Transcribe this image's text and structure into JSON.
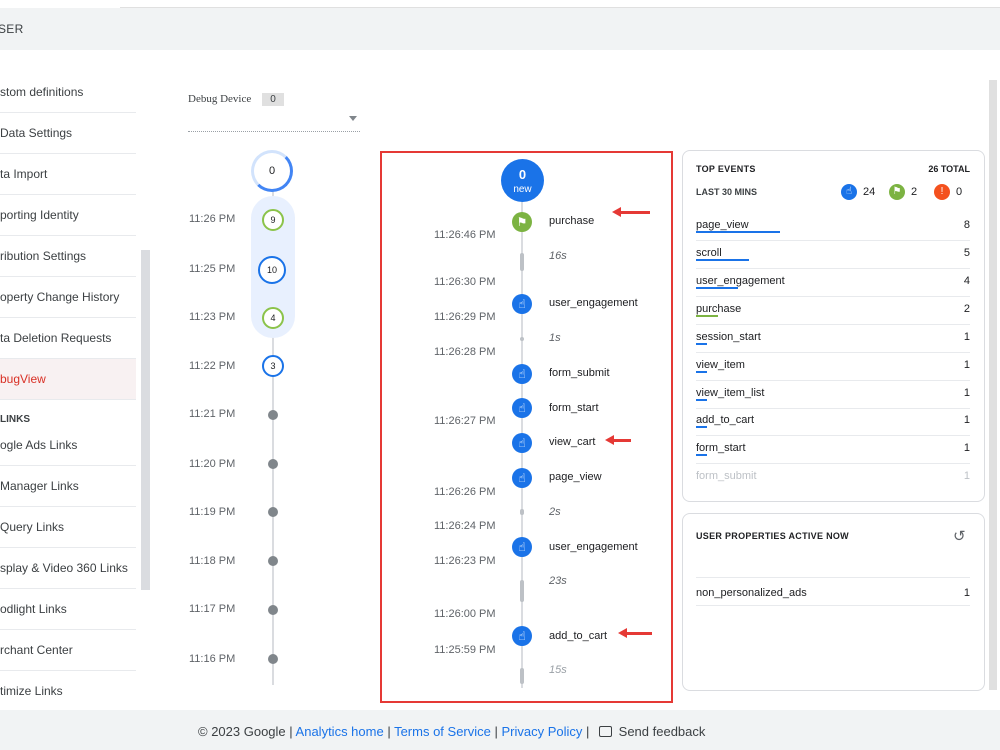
{
  "header": {
    "title": "SER"
  },
  "sidebar": {
    "items": [
      {
        "label": "stom definitions"
      },
      {
        "label": "Data Settings"
      },
      {
        "label": "ta Import"
      },
      {
        "label": "porting Identity"
      },
      {
        "label": "ribution Settings"
      },
      {
        "label": "operty Change History"
      },
      {
        "label": "ta Deletion Requests"
      },
      {
        "label": "bugView"
      }
    ],
    "links_heading": "LINKS",
    "link_items": [
      {
        "label": "ogle Ads Links"
      },
      {
        "label": "Manager Links"
      },
      {
        "label": "Query Links"
      },
      {
        "label": "splay & Video 360 Links"
      },
      {
        "label": "odlight Links"
      },
      {
        "label": "rchant Center"
      },
      {
        "label": "timize Links"
      }
    ]
  },
  "debug_device": {
    "label": "Debug Device",
    "count": "0"
  },
  "minutes_timeline": {
    "top_count": "0",
    "nodes": [
      {
        "time": "11:26 PM",
        "count": "9"
      },
      {
        "time": "11:25 PM",
        "count": "10"
      },
      {
        "time": "11:23 PM",
        "count": "4"
      },
      {
        "time": "11:22 PM",
        "count": "3"
      }
    ],
    "dots": [
      {
        "time": "11:21 PM"
      },
      {
        "time": "11:20 PM"
      },
      {
        "time": "11:19 PM"
      },
      {
        "time": "11:18 PM"
      },
      {
        "time": "11:17 PM"
      },
      {
        "time": "11:16 PM"
      }
    ]
  },
  "stream": {
    "new_count": "0",
    "new_label": "new",
    "times": [
      "11:26:46 PM",
      "11:26:30 PM",
      "11:26:29 PM",
      "11:26:28 PM",
      "11:26:27 PM",
      "11:26:26 PM",
      "11:26:24 PM",
      "11:26:23 PM",
      "11:26:00 PM",
      "11:25:59 PM"
    ],
    "events": [
      "purchase",
      "user_engagement",
      "form_submit",
      "form_start",
      "view_cart",
      "page_view",
      "user_engagement",
      "add_to_cart"
    ],
    "durations": [
      "16s",
      "1s",
      "2s",
      "23s",
      "15s"
    ]
  },
  "top_events": {
    "title": "TOP EVENTS",
    "total": "26 TOTAL",
    "range": "LAST 30 MINS",
    "counts": {
      "events": "24",
      "conversions": "2",
      "errors": "0"
    },
    "colors": {
      "events": "#1a73e8",
      "conversions": "#7cb342",
      "errors": "#f4511e"
    },
    "rows": [
      {
        "name": "page_view",
        "value": "8"
      },
      {
        "name": "scroll",
        "value": "5"
      },
      {
        "name": "user_engagement",
        "value": "4"
      },
      {
        "name": "purchase",
        "value": "2"
      },
      {
        "name": "session_start",
        "value": "1"
      },
      {
        "name": "view_item",
        "value": "1"
      },
      {
        "name": "view_item_list",
        "value": "1"
      },
      {
        "name": "add_to_cart",
        "value": "1"
      },
      {
        "name": "form_start",
        "value": "1"
      },
      {
        "name": "form_submit",
        "value": "1"
      }
    ]
  },
  "user_properties": {
    "title": "USER PROPERTIES ACTIVE NOW",
    "rows": [
      {
        "name": "non_personalized_ads",
        "value": "1"
      }
    ]
  },
  "footer": {
    "copyright": "© 2023 Google |",
    "links": [
      "Analytics home",
      "Terms of Service",
      "Privacy Policy"
    ],
    "feedback": "Send feedback"
  }
}
